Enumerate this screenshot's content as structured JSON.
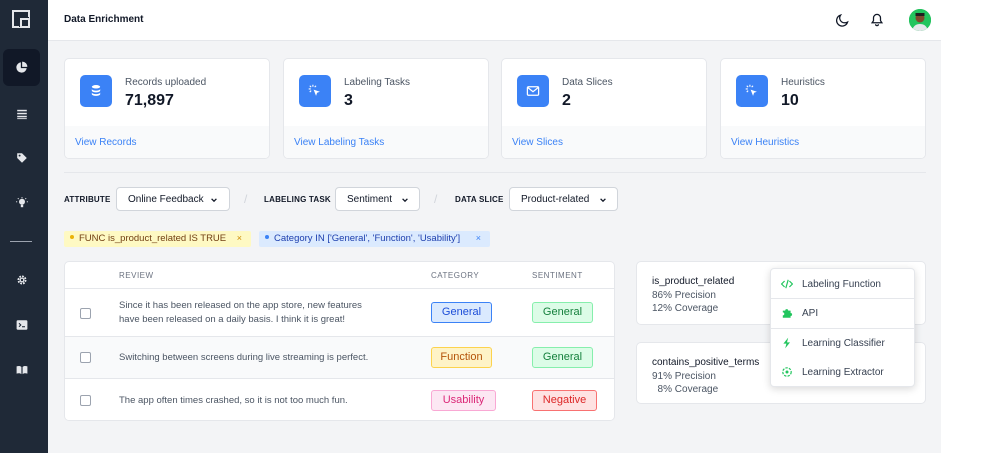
{
  "app": {
    "title": "Data Enrichment"
  },
  "stats": [
    {
      "label": "Records uploaded",
      "value": "71,897",
      "link": "View Records",
      "icon": "database-icon"
    },
    {
      "label": "Labeling Tasks",
      "value": "3",
      "link": "View Labeling Tasks",
      "icon": "cursor-click-icon"
    },
    {
      "label": "Data Slices",
      "value": "2",
      "link": "View Slices",
      "icon": "mail-icon"
    },
    {
      "label": "Heuristics",
      "value": "10",
      "link": "View Heuristics",
      "icon": "cursor-click-icon"
    }
  ],
  "filters": {
    "attribute": {
      "label": "ATTRIBUTE",
      "value": "Online Feedback"
    },
    "labeling_task": {
      "label": "LABELING TASK",
      "value": "Sentiment"
    },
    "data_slice": {
      "label": "DATA SLICE",
      "value": "Product-related"
    },
    "separator": "/"
  },
  "chips": [
    {
      "text": "FUNC is_product_related IS TRUE",
      "remove": "×"
    },
    {
      "text": "Category IN ['General', 'Function', 'Usability']",
      "remove": "×"
    }
  ],
  "table": {
    "headers": {
      "review": "REVIEW",
      "category": "CATEGORY",
      "sentiment": "SENTIMENT"
    },
    "rows": [
      {
        "review": "Since it has been released on the app store, new features have been released on a daily basis. I think it is great!",
        "category": "General",
        "sentiment": "General"
      },
      {
        "review": "Switching between screens during live streaming is perfect.",
        "category": "Function",
        "sentiment": "General"
      },
      {
        "review": "The app often times crashed, so it is not too much fun.",
        "category": "Usability",
        "sentiment": "Negative"
      }
    ]
  },
  "heuristics": [
    {
      "name": "is_product_related",
      "precision": "86% Precision",
      "coverage": "12% Coverage"
    },
    {
      "name": "contains_positive_terms",
      "precision": "91% Precision",
      "coverage": "  8% Coverage"
    }
  ],
  "dropdown": {
    "items": [
      {
        "label": "Labeling Function",
        "icon": "code-icon"
      },
      {
        "label": "API",
        "icon": "puzzle-icon"
      },
      {
        "label": "Learning Classifier",
        "icon": "lightning-icon"
      },
      {
        "label": "Learning Extractor",
        "icon": "target-icon"
      }
    ]
  },
  "colors": {
    "sidebar": "#1f2937",
    "accent": "#3b82f6",
    "general": "#dbeafe",
    "function": "#fef3c7",
    "usability": "#fce7f3",
    "positive": "#dcfce7",
    "negative": "#fee2e2",
    "dropdown_icon": "#22c55e"
  }
}
